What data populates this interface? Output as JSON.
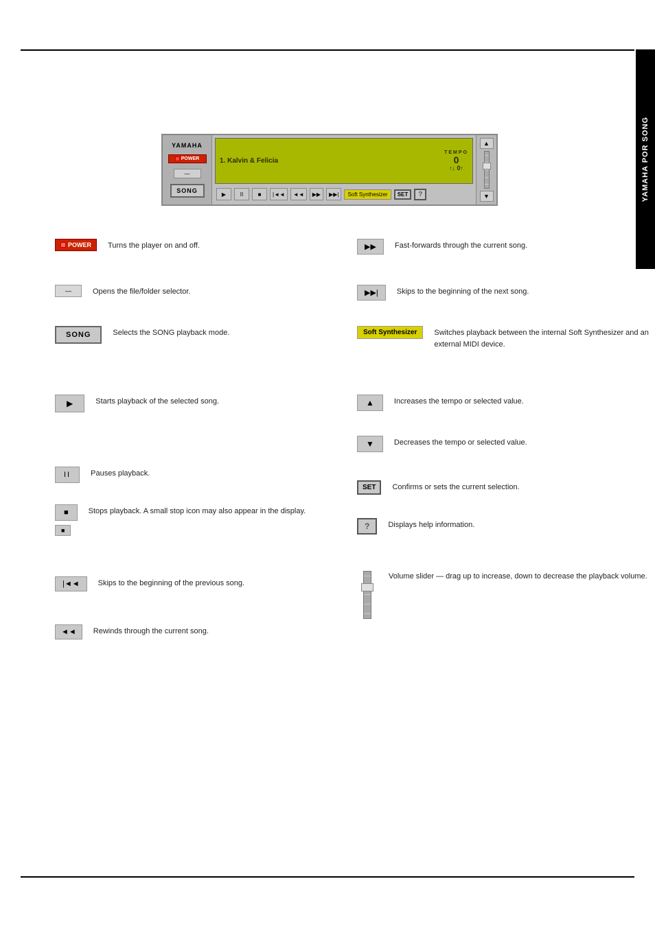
{
  "page": {
    "title": "YAMAHA POR SONG"
  },
  "player": {
    "brand": "YAMAHA",
    "power_label": "POWER",
    "song_label": "SONG",
    "lcd": {
      "song_name": "1.   Kalvin & Felicia",
      "tempo_label": "TEMPO",
      "tempo_value": "0",
      "beat_indicator": "↑↓ 0↑"
    },
    "transport": {
      "play": "▶",
      "pause": "II",
      "stop": "■",
      "prev_song": "|◄◄",
      "prev": "◄◄",
      "ff": "▶▶",
      "next_song": "▶▶|",
      "soft_synth": "Soft Synthesizer",
      "set": "SET",
      "help": "?"
    },
    "volume": {
      "up": "▲",
      "down": "▼"
    }
  },
  "descriptions": {
    "left_col": [
      {
        "btn_type": "power",
        "btn_label": "POWER",
        "text": "Turns the player on and off."
      },
      {
        "btn_type": "dash",
        "btn_label": "—",
        "text": "Opens the file/folder selector."
      },
      {
        "btn_type": "song",
        "btn_label": "SONG",
        "text": "Selects the SONG playback mode."
      },
      {
        "btn_type": "spacer",
        "btn_label": "",
        "text": ""
      },
      {
        "btn_type": "play",
        "btn_label": "▶",
        "text": "Starts playback of the selected song."
      },
      {
        "btn_type": "spacer2",
        "btn_label": "",
        "text": ""
      },
      {
        "btn_type": "pause",
        "btn_label": "II",
        "text": "Pauses playback."
      },
      {
        "btn_type": "stop",
        "btn_label": "■",
        "text": "Stops playback. A small stop icon may also appear in the display.",
        "stop_sm": "■"
      },
      {
        "btn_type": "prev_song",
        "btn_label": "|◄◄",
        "text": "Skips to the beginning of the previous song."
      },
      {
        "btn_type": "prev",
        "btn_label": "◄◄",
        "text": "Rewinds through the current song."
      }
    ],
    "right_col": [
      {
        "btn_type": "ff",
        "btn_label": "▶▶",
        "text": "Fast-forwards through the current song."
      },
      {
        "btn_type": "next_song",
        "btn_label": "▶▶|",
        "text": "Skips to the beginning of the next song."
      },
      {
        "btn_type": "soft_synth",
        "btn_label": "Soft Synthesizer",
        "text": "Switches playback between the internal Soft Synthesizer and an external MIDI device."
      },
      {
        "btn_type": "up",
        "btn_label": "▲",
        "text": "Increases the tempo or selected value."
      },
      {
        "btn_type": "down",
        "btn_label": "▼",
        "text": "Decreases the tempo or selected value."
      },
      {
        "btn_type": "set",
        "btn_label": "SET",
        "text": "Confirms or sets the current selection."
      },
      {
        "btn_type": "help",
        "btn_label": "?",
        "text": "Displays help information."
      },
      {
        "btn_type": "volume_slider",
        "text": "Volume slider — drag up to increase, down to decrease the playback volume."
      }
    ]
  }
}
